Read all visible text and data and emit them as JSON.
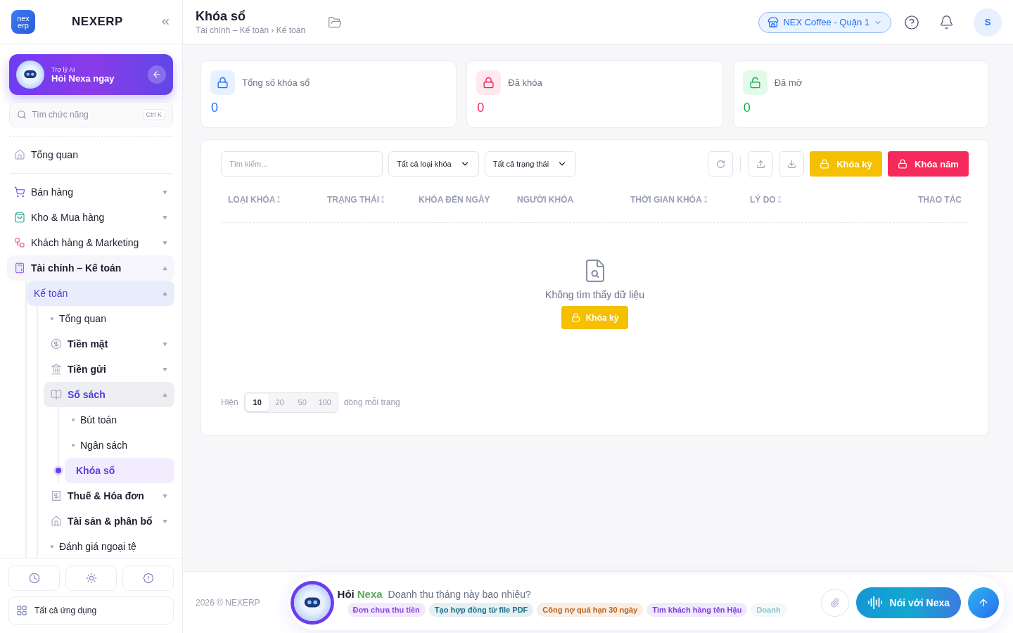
{
  "brand": {
    "logo": "nex",
    "logo_sub": "erp",
    "name": "NEXERP"
  },
  "assistant_card": {
    "caption": "Trợ lý AI",
    "title": "Hỏi Nexa ngay"
  },
  "feature_search": {
    "placeholder": "Tìm chức năng",
    "shortcut": "Ctrl K"
  },
  "sidebar": {
    "items": [
      {
        "label": "Tổng quan",
        "kind": "section",
        "selected": false
      },
      {
        "label": "Bán hàng",
        "kind": "section",
        "selected": false,
        "expanded": false
      },
      {
        "label": "Kho & Mua hàng",
        "kind": "section",
        "selected": false,
        "expanded": false
      },
      {
        "label": "Khách hàng & Marketing",
        "kind": "section",
        "selected": false,
        "expanded": false
      },
      {
        "label": "Tài chính – Kế toán",
        "kind": "section",
        "selected": false,
        "expanded": true,
        "children": [
          {
            "label": "Kế toán",
            "kind": "group",
            "selected": false,
            "expanded": true,
            "children": [
              {
                "label": "Tổng quan",
                "kind": "link",
                "selected": false
              },
              {
                "label": "Tiền mặt",
                "kind": "section",
                "selected": false,
                "expanded": false
              },
              {
                "label": "Tiền gửi",
                "kind": "section",
                "selected": false,
                "expanded": false
              },
              {
                "label": "Sổ sách",
                "kind": "section",
                "selected": false,
                "expanded": true,
                "children": [
                  {
                    "label": "Bút toán",
                    "kind": "link",
                    "selected": false
                  },
                  {
                    "label": "Ngân sách",
                    "kind": "link",
                    "selected": false
                  },
                  {
                    "label": "Khóa sổ",
                    "kind": "link",
                    "selected": true
                  }
                ]
              },
              {
                "label": "Thuế & Hóa đơn",
                "kind": "section",
                "selected": false,
                "expanded": false
              },
              {
                "label": "Tài sản & phân bổ",
                "kind": "section",
                "selected": false,
                "expanded": false
              },
              {
                "label": "Đánh giá ngoại tệ",
                "kind": "link",
                "selected": false
              }
            ]
          }
        ]
      }
    ]
  },
  "sidebar_footer": {
    "all_apps": "Tất cả ứng dụng"
  },
  "header": {
    "title": "Khóa sổ",
    "breadcrumb": "Tài chính – Kế toán › Kế toán",
    "store": "NEX Coffee - Quận 1",
    "avatar": "S"
  },
  "stats": [
    {
      "label": "Tổng số khóa sổ",
      "value": "0",
      "color": "#1e6ff5"
    },
    {
      "label": "Đã khóa",
      "value": "0",
      "color": "#f0245a"
    },
    {
      "label": "Đã mở",
      "value": "0",
      "color": "#16b34a"
    }
  ],
  "filters": {
    "search_placeholder": "Tìm kiếm...",
    "type_filter": "Tất cả loại khóa",
    "status_filter": "Tất cả trạng thái"
  },
  "actions": [
    {
      "label": "Khóa kỳ",
      "kind": "period"
    },
    {
      "label": "Khóa năm",
      "kind": "year"
    }
  ],
  "table": {
    "columns": [
      {
        "label": "LOẠI KHÓA",
        "sortable": true
      },
      {
        "label": "TRẠNG THÁI",
        "sortable": true
      },
      {
        "label": "KHÓA ĐẾN NGÀY",
        "sortable": false
      },
      {
        "label": "NGƯỜI KHÓA",
        "sortable": false
      },
      {
        "label": "THỜI GIAN KHÓA",
        "sortable": true
      },
      {
        "label": "LÝ DO",
        "sortable": true
      },
      {
        "label": "THAO TÁC",
        "sortable": false
      }
    ],
    "empty_text": "Không tìm thấy dữ liệu",
    "empty_action": "Khóa kỳ"
  },
  "pagination": {
    "prefix": "Hiện",
    "suffix": "dòng mỗi trang",
    "sizes": [
      {
        "label": "10",
        "selected": true
      },
      {
        "label": "20",
        "selected": false
      },
      {
        "label": "50",
        "selected": false
      },
      {
        "label": "100",
        "selected": false
      }
    ]
  },
  "footer": {
    "copyright": "2026 © NEXERP"
  },
  "ask_bar": {
    "label": "Hỏi",
    "brand": "Nexa",
    "prompt": "Doanh thu tháng này bao nhiêu?",
    "voice_button": "Nói với Nexa",
    "chips": [
      {
        "label": "Đơn chưa thu tiền",
        "color": "#8b3fe0"
      },
      {
        "label": "Tạo hợp đồng từ file PDF",
        "color": "#17708a"
      },
      {
        "label": "Công nợ quá hạn 30 ngày",
        "color": "#c0621a"
      },
      {
        "label": "Tìm khách hàng tên Hậu",
        "color": "#7b3fe0"
      },
      {
        "label": "Doanh",
        "color": "#8fc4cf"
      }
    ]
  }
}
